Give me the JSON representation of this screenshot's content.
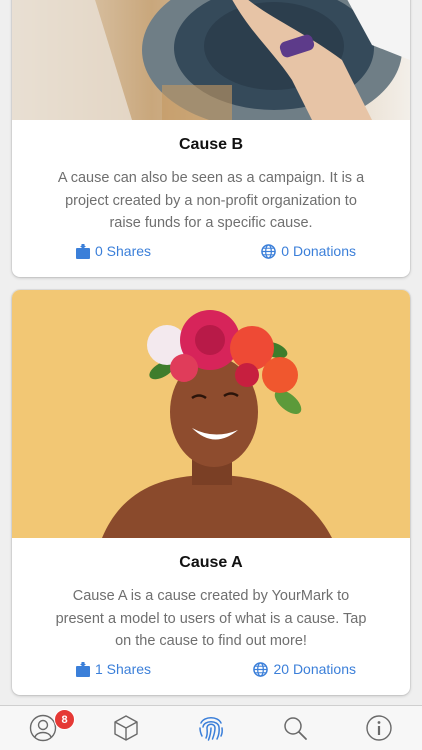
{
  "causes": [
    {
      "title": "Cause B",
      "description": "A cause can also be seen as a campaign. It is a project created by a non-profit organization to raise funds for a specific cause.",
      "shares_label": "0 Shares",
      "donations_label": "0 Donations",
      "image": "pottery-wheel-hands-photo"
    },
    {
      "title": "Cause A",
      "description": "Cause A is a cause created by YourMark to present a model to users of what is a cause. Tap on the cause to find out more!",
      "shares_label": "1 Shares",
      "donations_label": "20 Donations",
      "image": "woman-flower-crown-photo"
    }
  ],
  "tabbar": {
    "items": [
      {
        "icon": "user-icon",
        "badge": "8"
      },
      {
        "icon": "cube-icon"
      },
      {
        "icon": "fingerprint-icon",
        "active": true
      },
      {
        "icon": "search-icon"
      },
      {
        "icon": "info-icon"
      }
    ]
  },
  "colors": {
    "link": "#3b7fd9",
    "active_tab": "#3b7fd9",
    "inactive_tab": "#6a6a6a",
    "badge": "#e53935",
    "photo_a_bg": "#f2c774"
  }
}
